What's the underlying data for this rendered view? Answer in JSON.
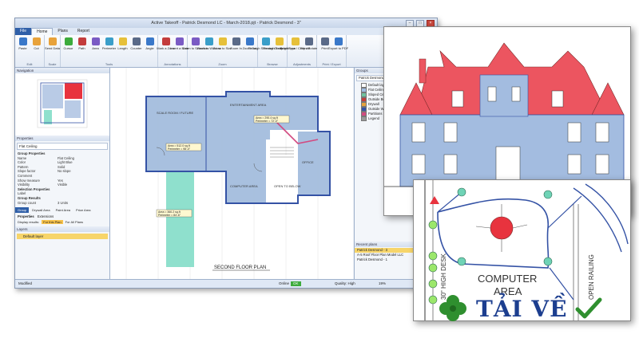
{
  "window": {
    "title": "Active Takeoff - Patrick Desmond LC - March-2018.pjt - Patrick Desmond - 3\"",
    "file_tab": "File",
    "tabs": [
      "Home",
      "Plans",
      "Report"
    ]
  },
  "ribbon": {
    "groups": [
      {
        "label": "Edit",
        "items": [
          "Paste",
          "Cut"
        ]
      },
      {
        "label": "Scale",
        "items": [
          "Send Data"
        ]
      },
      {
        "label": "Tools",
        "items": [
          "Cursor",
          "Path",
          "Area",
          "Perimeter",
          "Length",
          "Counter",
          "Angle"
        ]
      },
      {
        "label": "Annotations",
        "items": [
          "Mark a Zone",
          "Insert a Note"
        ]
      },
      {
        "label": "Zoom",
        "items": [
          "Zoom to Selection",
          "Zoom to Window",
          "Zoom to Size",
          "Zoom In",
          "Zoom Out"
        ]
      },
      {
        "label": "Browse",
        "items": [
          "Through Selected Group",
          "Through Selected Type"
        ]
      },
      {
        "label": "Adjustments",
        "items": [
          "Brightness / Contrast",
          "Flip / Rotate"
        ]
      },
      {
        "label": "Print / Export",
        "items": [
          "Print",
          "Export to PDF"
        ]
      }
    ]
  },
  "navigation": {
    "title": "Navigation"
  },
  "properties": {
    "title": "Properties",
    "selected": "Flat Ceiling",
    "rows": [
      {
        "k": "Group Properties",
        "v": "",
        "group": true
      },
      {
        "k": "Name",
        "v": "Flat Ceiling"
      },
      {
        "k": "Color",
        "v": "Light Blue"
      },
      {
        "k": "Pattern",
        "v": "Solid"
      },
      {
        "k": "Slope factor",
        "v": "No slope"
      },
      {
        "k": "Comment",
        "v": ""
      },
      {
        "k": "Show measure",
        "v": "Yes"
      },
      {
        "k": "Visibility",
        "v": "Visible"
      },
      {
        "k": "Selection Properties",
        "v": "",
        "group": true
      },
      {
        "k": "Label",
        "v": ""
      },
      {
        "k": "Group Results",
        "v": "",
        "group": true
      },
      {
        "k": "Group count",
        "v": "3 Units"
      }
    ],
    "bottom_tabs": [
      "Group",
      "Drywall Area",
      "Paint Area",
      "Price Area"
    ],
    "sub_tabs": [
      "Properties",
      "Extensions"
    ],
    "display_results": "Display results:",
    "this_plan": "For this Plan",
    "all_plans": "For All Plans"
  },
  "layers": {
    "title": "Layers",
    "items": [
      "Default layer"
    ]
  },
  "groups": {
    "title": "Groups",
    "header": "Patrick Desmond",
    "items": [
      {
        "label": "Default layer",
        "color": "#ffffff"
      },
      {
        "label": "Flat Ceiling",
        "color": "#9fbde3"
      },
      {
        "label": "Sloped Ceiling",
        "color": "#6fc3a0"
      },
      {
        "label": "Outside Border",
        "color": "#c33c3c"
      },
      {
        "label": "Drywall",
        "color": "#e6a23c"
      },
      {
        "label": "Outside Walls",
        "color": "#3452a5"
      },
      {
        "label": "Partitions",
        "color": "#d24a80"
      },
      {
        "label": "Legend",
        "color": "#999999"
      }
    ]
  },
  "recent": {
    "title": "Recent plans",
    "items": [
      "Patrick Desmond - 3",
      "A-5 Roof Floor Plan Model LLC",
      "Patrick Desmond - 1"
    ]
  },
  "status": {
    "left": "Modified",
    "online_label": "Online",
    "online_state": "OK",
    "quality": "Quality: High",
    "zoom": "19%"
  },
  "plan": {
    "title": "SECOND FLOOR PLAN",
    "rooms": [
      "SCALE ROOM / FUTURE",
      "ENTERTAINMENT AREA",
      "COMPUTER AREA",
      "OPEN TO BELOW",
      "OFFICE"
    ]
  },
  "detail": {
    "labels": [
      "COMPUTER",
      "AREA",
      "30\" HIGH DESK",
      "OPEN RAILING"
    ]
  },
  "brand": {
    "text": "TẢI VỀ"
  }
}
